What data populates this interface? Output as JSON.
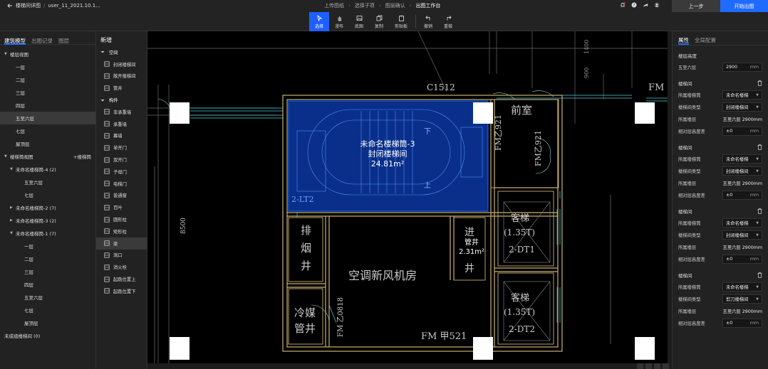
{
  "topbar": {
    "back_label": "楼梯间详图",
    "file_name": "user_11_2021.10.1...",
    "breadcrumbs": [
      "上传图纸",
      "选择子项",
      "图层确认",
      "出图工作台"
    ],
    "tools": [
      {
        "label": "选择",
        "icon": "cursor-icon",
        "active": true
      },
      {
        "label": "漫布",
        "icon": "hand-icon"
      },
      {
        "label": "底图",
        "icon": "image-icon"
      },
      {
        "label": "复制",
        "icon": "copy-icon"
      },
      {
        "label": "剪贴板",
        "icon": "clipboard-icon"
      },
      {
        "label": "撤销",
        "icon": "undo-icon"
      },
      {
        "label": "重做",
        "icon": "redo-icon"
      }
    ],
    "prev_label": "上一步",
    "start_label": "开始出图"
  },
  "left": {
    "tabs": [
      "建筑模型",
      "出图记录",
      "图层"
    ],
    "tree": [
      {
        "label": "楼层视图",
        "level": 0,
        "arrow": "▼"
      },
      {
        "label": "一层",
        "level": 2
      },
      {
        "label": "二层",
        "level": 2
      },
      {
        "label": "三层",
        "level": 2
      },
      {
        "label": "四层",
        "level": 2
      },
      {
        "label": "五至六层",
        "level": 2,
        "selected": true
      },
      {
        "label": "七层",
        "level": 2
      },
      {
        "label": "屋顶层",
        "level": 2
      },
      {
        "label": "楼梯筒视图",
        "level": 0,
        "arrow": "▼",
        "action": "+楼梯筒"
      },
      {
        "label": "未命名楼梯筒-4 (2)",
        "level": 1,
        "arrow": "▼"
      },
      {
        "label": "五至六层",
        "level": 3
      },
      {
        "label": "七层",
        "level": 3
      },
      {
        "label": "未命名楼梯筒-2 (7)",
        "level": 1,
        "arrow": "▶"
      },
      {
        "label": "未命名楼梯筒-3 (2)",
        "level": 1,
        "arrow": "▶"
      },
      {
        "label": "未命名楼梯筒-1 (7)",
        "level": 1,
        "arrow": "▼"
      },
      {
        "label": "一层",
        "level": 3
      },
      {
        "label": "二层",
        "level": 3
      },
      {
        "label": "三层",
        "level": 3
      },
      {
        "label": "四层",
        "level": 3
      },
      {
        "label": "五至六层",
        "level": 3
      },
      {
        "label": "七层",
        "level": 3
      },
      {
        "label": "屋顶层",
        "level": 3
      },
      {
        "label": "未成组楼梯间 (0)",
        "level": 0
      }
    ]
  },
  "mid": {
    "title": "新增",
    "items": [
      {
        "label": "空间",
        "group": true
      },
      {
        "label": "封闭楼梯间",
        "icon": "closed-stair-icon"
      },
      {
        "label": "敞开楼梯间",
        "icon": "open-stair-icon"
      },
      {
        "label": "管井",
        "icon": "shaft-icon"
      },
      {
        "label": "构件",
        "group": true
      },
      {
        "label": "非承重墙",
        "icon": "nonbearing-wall-icon"
      },
      {
        "label": "承重墙",
        "icon": "bearing-wall-icon"
      },
      {
        "label": "幕墙",
        "icon": "curtain-wall-icon"
      },
      {
        "label": "单开门",
        "icon": "single-door-icon"
      },
      {
        "label": "双开门",
        "icon": "double-door-icon"
      },
      {
        "label": "子母门",
        "icon": "unequal-door-icon"
      },
      {
        "label": "电梯门",
        "icon": "elevator-door-icon"
      },
      {
        "label": "普通窗",
        "icon": "window-icon"
      },
      {
        "label": "百叶",
        "icon": "louver-icon"
      },
      {
        "label": "圆形柱",
        "icon": "round-column-icon"
      },
      {
        "label": "矩形柱",
        "icon": "rect-column-icon"
      },
      {
        "label": "梁",
        "icon": "beam-icon",
        "hover": true
      },
      {
        "label": "洞口",
        "icon": "opening-icon"
      },
      {
        "label": "消火栓",
        "icon": "hydrant-icon"
      },
      {
        "label": "起跑位置上",
        "icon": "start-up-icon"
      },
      {
        "label": "起跑位置下",
        "icon": "start-down-icon"
      }
    ]
  },
  "canvas": {
    "stair_name": "未命名楼梯筒-3",
    "stair_type": "封闭楼梯间",
    "stair_area": "24.81m²",
    "shaft_name": "管井",
    "shaft_area": "2.31m²",
    "labels": {
      "c1512": "C1512",
      "qianshi": "前室",
      "fmz1": "FM乙921",
      "fmz2": "FM乙921",
      "fm_top": "FM 乙",
      "lt2": "2-LT2",
      "dim8500": "8500",
      "pai": "排烟井",
      "jin": "进",
      "jing": "井",
      "kongtiao": "空调新风机房",
      "lengmei": "冷媒管井",
      "fm0818": "FM 乙0818",
      "fm521": "FM 甲521",
      "keti1": "客梯",
      "keti1b": "(1.35T)",
      "keti1c": "2-DT1",
      "keti2": "客梯",
      "keti2b": "(1.35T)",
      "keti2c": "2-DT2",
      "xia": "下",
      "shang": "上",
      "dim1400": "1400",
      "dim900": "900"
    }
  },
  "right": {
    "tabs": [
      "属性",
      "全局配置"
    ],
    "floor_height_label": "楼层高度",
    "floor_name": "五至六层",
    "floor_height_value": "2900",
    "unit": "mm",
    "sections": [
      {
        "title": "楼梯间",
        "rows": [
          {
            "label": "所属楼梯筒",
            "value": "未命名楼梯",
            "type": "select"
          },
          {
            "label": "楼梯间类型",
            "value": "封闭楼梯间",
            "type": "select"
          },
          {
            "label": "所属楼层",
            "value": "五至六层 2900mm",
            "type": "text"
          },
          {
            "label": "相对层高度差",
            "value": "±0",
            "type": "input"
          }
        ]
      },
      {
        "title": "楼梯间",
        "rows": [
          {
            "label": "所属楼梯筒",
            "value": "未命名楼梯",
            "type": "select"
          },
          {
            "label": "楼梯间类型",
            "value": "封闭楼梯间",
            "type": "select"
          },
          {
            "label": "所属楼层",
            "value": "五至六层 2900mm",
            "type": "text"
          },
          {
            "label": "相对层高度差",
            "value": "±0",
            "type": "input"
          }
        ]
      },
      {
        "title": "楼梯间",
        "rows": [
          {
            "label": "所属楼梯筒",
            "value": "未命名楼梯",
            "type": "select"
          },
          {
            "label": "楼梯间类型",
            "value": "封闭楼梯间",
            "type": "select"
          },
          {
            "label": "所属楼层",
            "value": "五至六层 2900mm",
            "type": "text"
          },
          {
            "label": "相对层高度差",
            "value": "±0",
            "type": "input"
          }
        ]
      },
      {
        "title": "楼梯间",
        "rows": [
          {
            "label": "所属楼梯筒",
            "value": "未命名楼梯",
            "type": "select"
          },
          {
            "label": "楼梯间类型",
            "value": "剪刀楼梯间",
            "type": "select"
          },
          {
            "label": "所属楼层",
            "value": "五至六层 2900mm",
            "type": "text"
          },
          {
            "label": "相对层高度差",
            "value": "±0",
            "type": "input"
          }
        ]
      }
    ]
  },
  "colors": {
    "accent": "#1f6bff",
    "stair_fill": "#0a2f8a",
    "wall": "#c8b070"
  }
}
